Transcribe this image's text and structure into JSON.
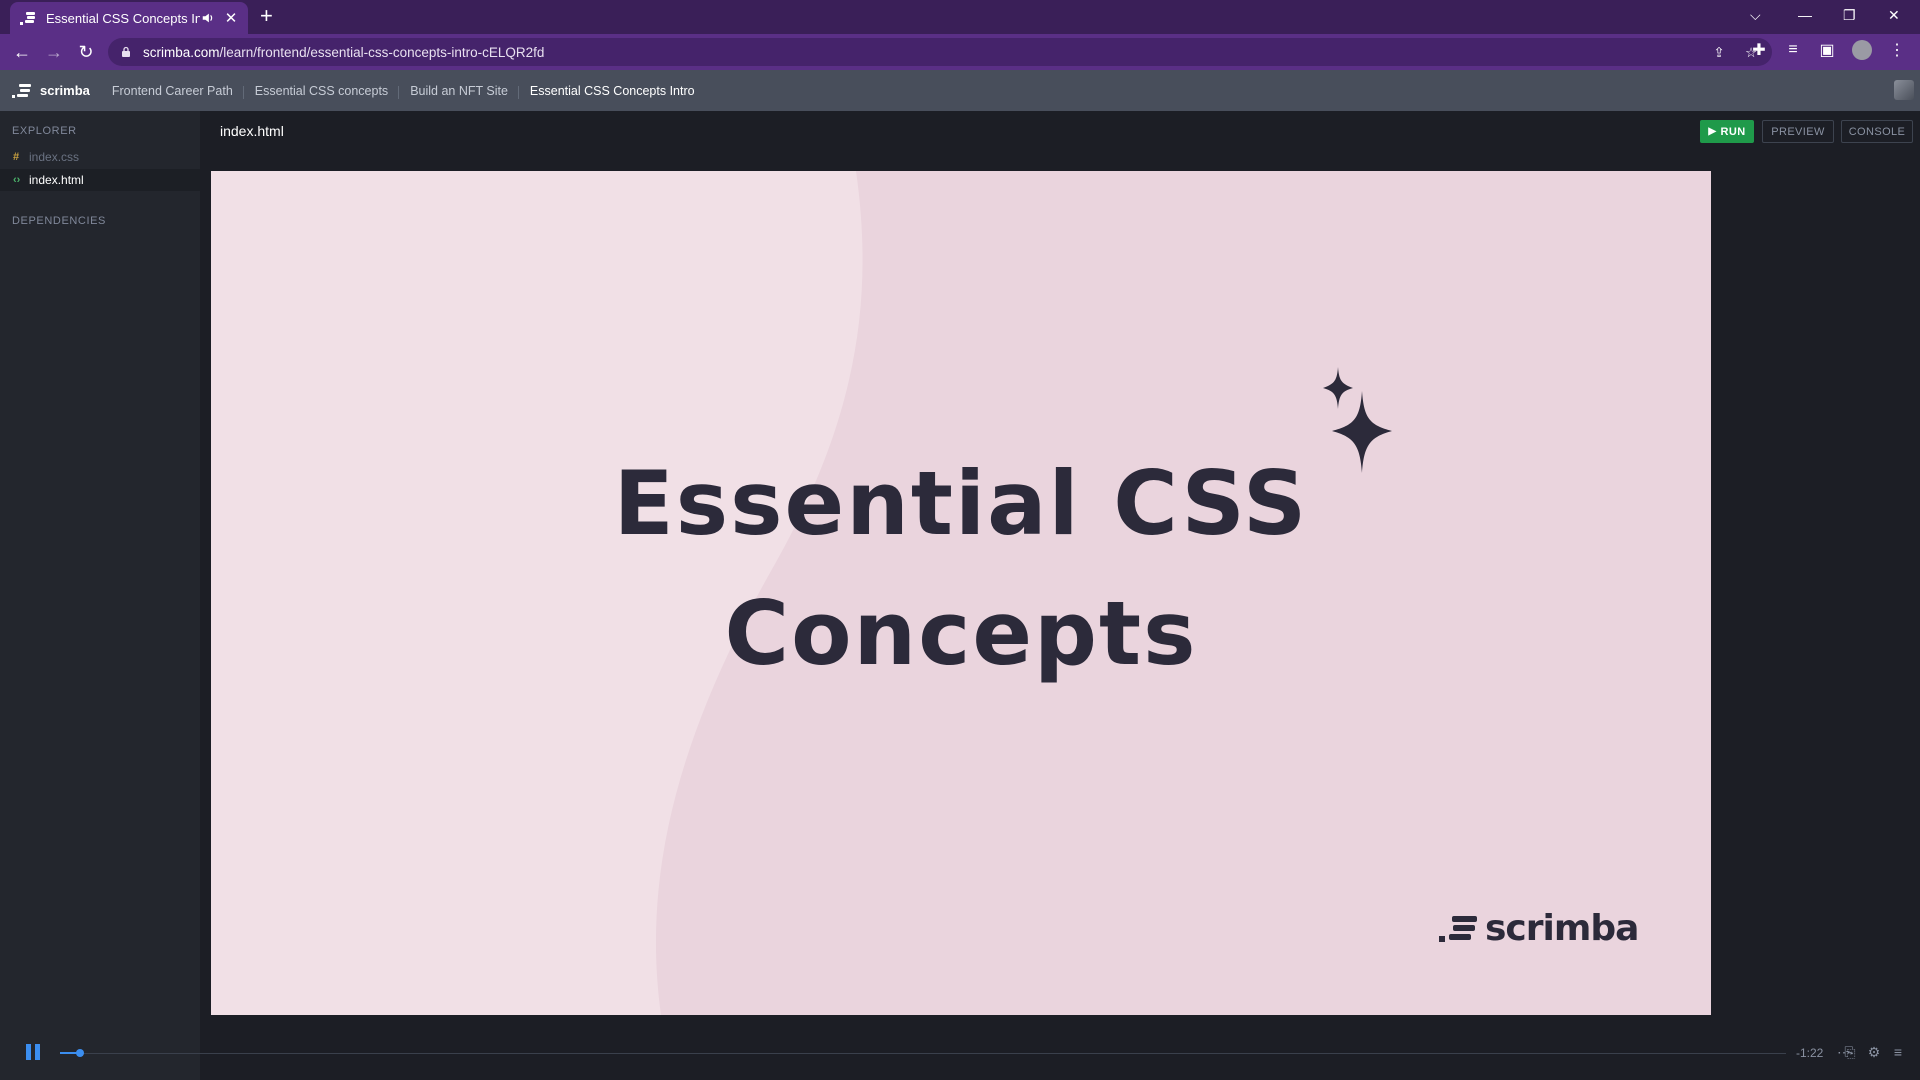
{
  "browser": {
    "tab_title": "Essential CSS Concepts Intro",
    "new_tab": "+",
    "url_host": "scrimba.com",
    "url_path": "/learn/frontend/essential-css-concepts-intro-cELQR2fd"
  },
  "appbar": {
    "brand": "scrimba",
    "breadcrumbs": [
      "Frontend Career Path",
      "Essential CSS concepts",
      "Build an NFT Site",
      "Essential CSS Concepts Intro"
    ]
  },
  "sidebar": {
    "explorer_label": "EXPLORER",
    "files": [
      "index.css",
      "index.html"
    ],
    "dependencies_label": "DEPENDENCIES"
  },
  "editor": {
    "active_file": "index.html",
    "run_label": "RUN",
    "preview_label": "PREVIEW",
    "console_label": "CONSOLE"
  },
  "slide": {
    "title_line1": "Essential CSS",
    "title_line2": "Concepts",
    "logo_text": "scrimba",
    "bg_color": "#ead4dd",
    "text_color": "#2c2a3a"
  },
  "player": {
    "time_remaining": "-1:22",
    "progress": 0.011
  }
}
